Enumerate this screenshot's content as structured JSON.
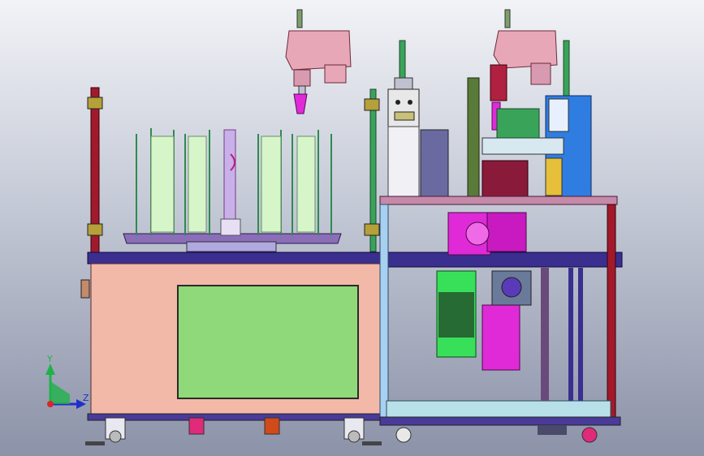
{
  "viewport": {
    "background_top": "#f2f3f7",
    "background_bottom": "#8c92a8"
  },
  "triad": {
    "y_label": "Y",
    "x_label": "X",
    "z_label": "Z",
    "y_color": "#1fb24a",
    "x_color": "#d8262c",
    "z_color": "#2030c8"
  },
  "palette": {
    "cabinet_panel": "#f2b9a8",
    "window_panel": "#8fd97a",
    "frame_blue": "#3a2f8f",
    "base_plate": "#6b5fb0",
    "robot_pink": "#e8a7b7",
    "motor_green": "#38e05a",
    "motor_magenta": "#e02ad8",
    "post_dark_red": "#a01a2c",
    "cylinder_green": "#d6f5c8",
    "rod_green": "#3aa35a",
    "info_blue": "#2f7de0"
  }
}
